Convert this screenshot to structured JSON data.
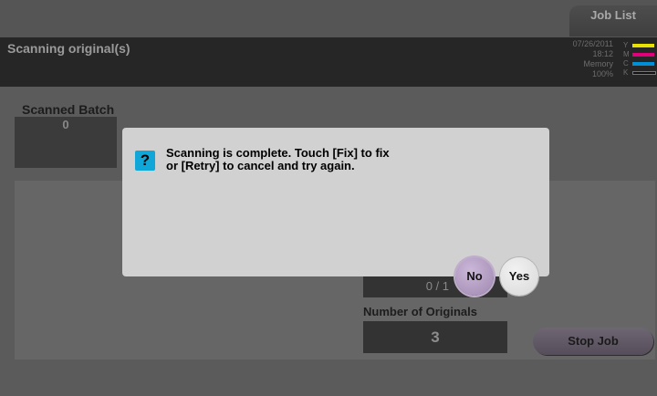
{
  "top_bar": {
    "job_list_label": "Job List"
  },
  "header": {
    "title": "Scanning original(s)",
    "date": "07/26/2011",
    "time": "18:12",
    "memory_label": "Memory",
    "memory_value": "100%",
    "ink_levels": [
      {
        "label": "Y",
        "color": "#e8e100"
      },
      {
        "label": "M",
        "color": "#e0007a"
      },
      {
        "label": "C",
        "color": "#0090d8"
      },
      {
        "label": "K",
        "color": "#111111"
      }
    ]
  },
  "scanned_batch": {
    "label": "Scanned Batch",
    "value": "0"
  },
  "progress": {
    "counter": "0 / 1"
  },
  "originals": {
    "label": "Number of Originals",
    "value": "3"
  },
  "stop_job_label": "Stop Job",
  "dialog": {
    "icon": "question-icon",
    "icon_glyph": "?",
    "message": "Scanning is complete. Touch [Fix] to fix\nor [Retry] to cancel and try again.",
    "no_label": "No",
    "yes_label": "Yes"
  }
}
